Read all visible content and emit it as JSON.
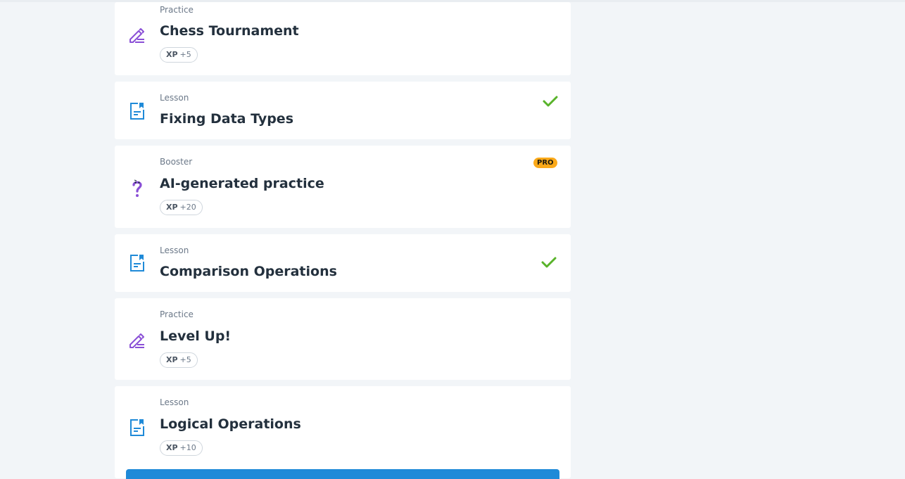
{
  "items": [
    {
      "kind": "Practice",
      "title": "Chess Tournament",
      "xp_label": "XP",
      "xp_value": "+5",
      "icon": "practice-pencil-icon",
      "completed": false,
      "pro": false
    },
    {
      "kind": "Lesson",
      "title": "Fixing Data Types",
      "icon": "lesson-document-icon",
      "completed": true,
      "pro": false
    },
    {
      "kind": "Booster",
      "title": "AI-generated practice",
      "xp_label": "XP",
      "xp_value": "+20",
      "icon": "booster-question-icon",
      "completed": false,
      "pro": true,
      "pro_label": "PRO"
    },
    {
      "kind": "Lesson",
      "title": "Comparison Operations",
      "icon": "lesson-document-icon",
      "completed": true,
      "pro": false
    },
    {
      "kind": "Practice",
      "title": "Level Up!",
      "xp_label": "XP",
      "xp_value": "+5",
      "icon": "practice-pencil-icon",
      "completed": false,
      "pro": false
    },
    {
      "kind": "Lesson",
      "title": "Logical Operations",
      "xp_label": "XP",
      "xp_value": "+10",
      "icon": "lesson-document-icon",
      "completed": false,
      "pro": false
    }
  ],
  "colors": {
    "practice_icon": "#8a4fd6",
    "lesson_icon": "#1f8ad8",
    "check": "#58b32a",
    "pro_badge": "#fba919",
    "primary_button": "#1f8ad8"
  }
}
